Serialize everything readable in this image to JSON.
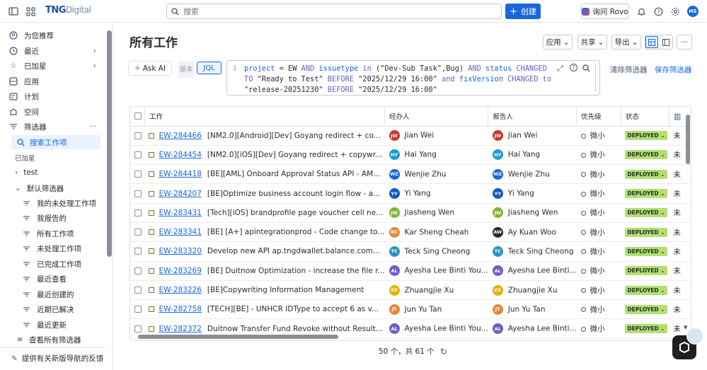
{
  "topbar": {
    "logo_main": "TNG",
    "logo_sub": "Digital",
    "search_placeholder": "搜索",
    "create_label": "创建",
    "rovo_label": "询问 Rovo",
    "user_initials": "HS"
  },
  "sidebar": {
    "items": [
      {
        "label": "为您推荐",
        "icon": "for-you-icon"
      },
      {
        "label": "最近",
        "icon": "clock-icon"
      },
      {
        "label": "已加星",
        "icon": "star-icon"
      },
      {
        "label": "应用",
        "icon": "apps-icon"
      },
      {
        "label": "计划",
        "icon": "plans-icon"
      },
      {
        "label": "空间",
        "icon": "spaces-icon"
      },
      {
        "label": "筛选器",
        "icon": "filter-icon"
      },
      {
        "label": "搜索工作项",
        "icon": "search-icon"
      }
    ],
    "starred_section": "已加星",
    "starred_items": [
      "test"
    ],
    "default_filters_label": "默认筛选器",
    "default_filters": [
      "我的未处理工作项",
      "我报告的",
      "所有工作项",
      "未处理工作项",
      "已完成工作项",
      "最近查看",
      "最近创建的",
      "近期已解决",
      "最近更新"
    ],
    "view_all_filters": "查看所有筛选器",
    "feedback_label": "提供有关新版导航的反馈"
  },
  "header": {
    "title": "所有工作",
    "apps_btn": "应用",
    "share_btn": "共享",
    "export_btn": "导出"
  },
  "query": {
    "ask_ai_label": "Ask AI",
    "basic_label": "基本",
    "jql_label": "JQL",
    "line_number": "1",
    "clear_label": "清除筛选器",
    "save_label": "保存筛选器"
  },
  "table": {
    "columns": [
      "工作",
      "经办人",
      "报告人",
      "优先级",
      "状态"
    ],
    "rows": [
      {
        "key": "EW-284466",
        "summary": "[NM2.0][Android][Dev] Goyang redirect + co...",
        "assignee": "Jian Wei",
        "assignee_initials": "JW",
        "assignee_color": "#c9372c",
        "reporter": "Jian Wei",
        "reporter_initials": "JW",
        "reporter_color": "#c9372c",
        "priority": "微小",
        "status": "DEPLOYED",
        "resolution": "未"
      },
      {
        "key": "EW-284454",
        "summary": "[NM2.0][iOS][Dev] Goyang redirect + copywr...",
        "assignee": "Hai Yang",
        "assignee_initials": "HY",
        "assignee_color": "#1d9bd1",
        "reporter": "Hai Yang",
        "reporter_initials": "HY",
        "reporter_color": "#1d9bd1",
        "priority": "微小",
        "status": "DEPLOYED",
        "resolution": "未"
      },
      {
        "key": "EW-284418",
        "summary": "[BE][AML] Onboard Approval Status API - AM...",
        "assignee": "Wenjie Zhu",
        "assignee_initials": "WZ",
        "assignee_color": "#1868db",
        "reporter": "Wenjie Zhu",
        "reporter_initials": "WZ",
        "reporter_color": "#1868db",
        "priority": "微小",
        "status": "DEPLOYED",
        "resolution": "未"
      },
      {
        "key": "EW-284207",
        "summary": "[BE]Optimize business account login flow - a...",
        "assignee": "Yi Yang",
        "assignee_initials": "YY",
        "assignee_color": "#1558bc",
        "reporter": "Yi Yang",
        "reporter_initials": "YY",
        "reporter_color": "#1558bc",
        "priority": "微小",
        "status": "DEPLOYED",
        "resolution": "未"
      },
      {
        "key": "EW-283431",
        "summary": "[Tech][iOS] brandprofile page voucher cell ne...",
        "assignee": "Jiasheng Wen",
        "assignee_initials": "JW",
        "assignee_color": "#82b536",
        "reporter": "Jiasheng Wen",
        "reporter_initials": "JW",
        "reporter_color": "#82b536",
        "priority": "微小",
        "status": "DEPLOYED",
        "resolution": "未"
      },
      {
        "key": "EW-283341",
        "summary": "[BE] [A+] apintegrationprod - Code change to...",
        "assignee": "Kar Sheng Cheah",
        "assignee_initials": "KC",
        "assignee_color": "#e2893d",
        "reporter": "Ay Kuan Woo",
        "reporter_initials": "AW",
        "reporter_color": "#292a2e",
        "priority": "微小",
        "status": "DEPLOYED",
        "resolution": "未"
      },
      {
        "key": "EW-283320",
        "summary": "Develop new API ap.tngdwallet.balance.com...",
        "assignee": "Teck Sing Cheong",
        "assignee_initials": "TC",
        "assignee_color": "#2898bd",
        "reporter": "Teck Sing Cheong",
        "reporter_initials": "TC",
        "reporter_color": "#2898bd",
        "priority": "微小",
        "status": "DEPLOYED",
        "resolution": "未"
      },
      {
        "key": "EW-283269",
        "summary": "[BE] Duitnow Optimization - increase the file r...",
        "assignee": "Ayesha Lee Binti You...",
        "assignee_initials": "AL",
        "assignee_color": "#6e5dc6",
        "reporter": "Ayesha Lee Binti...",
        "reporter_initials": "AL",
        "reporter_color": "#6e5dc6",
        "priority": "微小",
        "status": "DEPLOYED",
        "resolution": "未"
      },
      {
        "key": "EW-283226",
        "summary": "[BE]Copywriting Information Management",
        "assignee": "Zhuangjie Xu",
        "assignee_initials": "ZX",
        "assignee_color": "#e2b203",
        "reporter": "Zhuangjie Xu",
        "reporter_initials": "ZX",
        "reporter_color": "#e2b203",
        "priority": "微小",
        "status": "DEPLOYED",
        "resolution": "未"
      },
      {
        "key": "EW-282758",
        "summary": "[TECH][BE] - UNHCR IDType to accept 6 as v...",
        "assignee": "Jun Yu Tan",
        "assignee_initials": "JT",
        "assignee_color": "#e2893d",
        "reporter": "Jun Yu Tan",
        "reporter_initials": "JT",
        "reporter_color": "#e2893d",
        "priority": "微小",
        "status": "DEPLOYED",
        "resolution": "未"
      },
      {
        "key": "EW-282372",
        "summary": "Duitnow Transfer Fund Revoke without Result...",
        "assignee": "Ayesha Lee Binti You...",
        "assignee_initials": "AL",
        "assignee_color": "#6e5dc6",
        "reporter": "Ayesha Lee Binti...",
        "reporter_initials": "AL",
        "reporter_color": "#6e5dc6",
        "priority": "微小",
        "status": "DEPLOYED",
        "resolution": "未"
      }
    ]
  },
  "pager": {
    "label": "50 个，共 61 个"
  }
}
